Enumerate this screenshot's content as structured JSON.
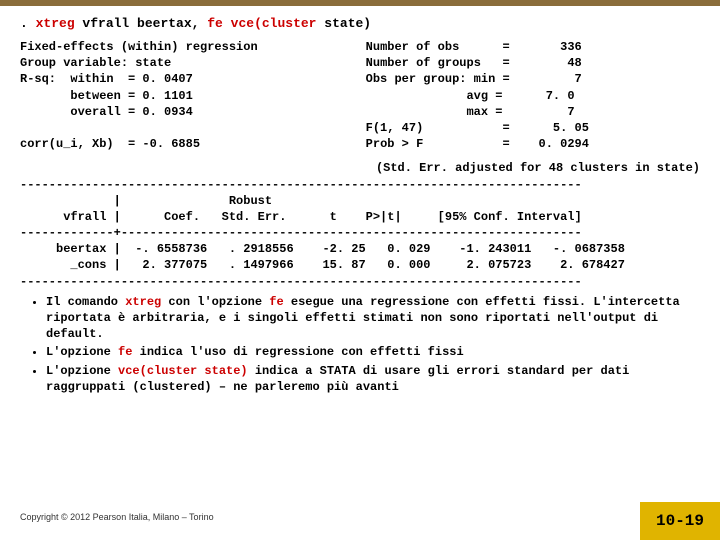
{
  "cmd": {
    "prompt": ". ",
    "c1": "xtreg",
    "args1": " vfrall beertax, ",
    "c2": "fe",
    "args2": " ",
    "c3": "vce(cluster",
    "args3": " state)"
  },
  "stats": {
    "l1a": "Fixed-effects (within) regression",
    "l1b": "Number of obs      =",
    "l1v": "336",
    "l2a": "Group variable: state",
    "l2b": "Number of groups   =",
    "l2v": "48",
    "l3a": "R-sq:  within  = 0. 0407",
    "l3b": "Obs per group: min =",
    "l3v": "7",
    "l4a": "       between = 0. 1101",
    "l4b": "avg =",
    "l4v": "7. 0",
    "l5a": "       overall = 0. 0934",
    "l5b": "max =",
    "l5v": "7",
    "l6b": "F(1, 47)           =",
    "l6v": "5. 05",
    "l7a": "corr(u_i, Xb)  = -0. 6885",
    "l7b": "Prob > F           =",
    "l7v": "0. 0294"
  },
  "adj": "(Std. Err. adjusted for 48 clusters in state)",
  "rule": "------------------------------------------------------------------------------",
  "tbl": {
    "h1": "             |               Robust",
    "h2": "      vfrall |      Coef.   Std. Err.      t    P>|t|     [95% Conf. Interval]",
    "sep": "-------------+----------------------------------------------------------------",
    "r1": "     beertax |  -. 6558736   . 2918556    -2. 25   0. 029    -1. 243011   -. 0687358",
    "r2": "       _cons |   2. 377075   . 1497966    15. 87   0. 000     2. 075723    2. 678427"
  },
  "bul": {
    "b1a": "Il comando ",
    "b1k": "xtreg",
    "b1b": " con l'opzione ",
    "b1k2": "fe",
    "b1c": " esegue una regressione con effetti fissi. L'intercetta riportata è arbitraria, e i singoli effetti stimati non sono riportati nell'output di default.",
    "b2a": "L'opzione ",
    "b2k": "fe",
    "b2b": " indica l'uso di regressione con effetti fissi",
    "b3a": "L'opzione ",
    "b3k": "vce(cluster state)",
    "b3b": " indica a STATA di usare gli errori standard per dati raggruppati (clustered) – ne parleremo più avanti"
  },
  "footer": {
    "left": "Copyright © 2012 Pearson Italia, Milano – Torino",
    "right": "10-19"
  }
}
